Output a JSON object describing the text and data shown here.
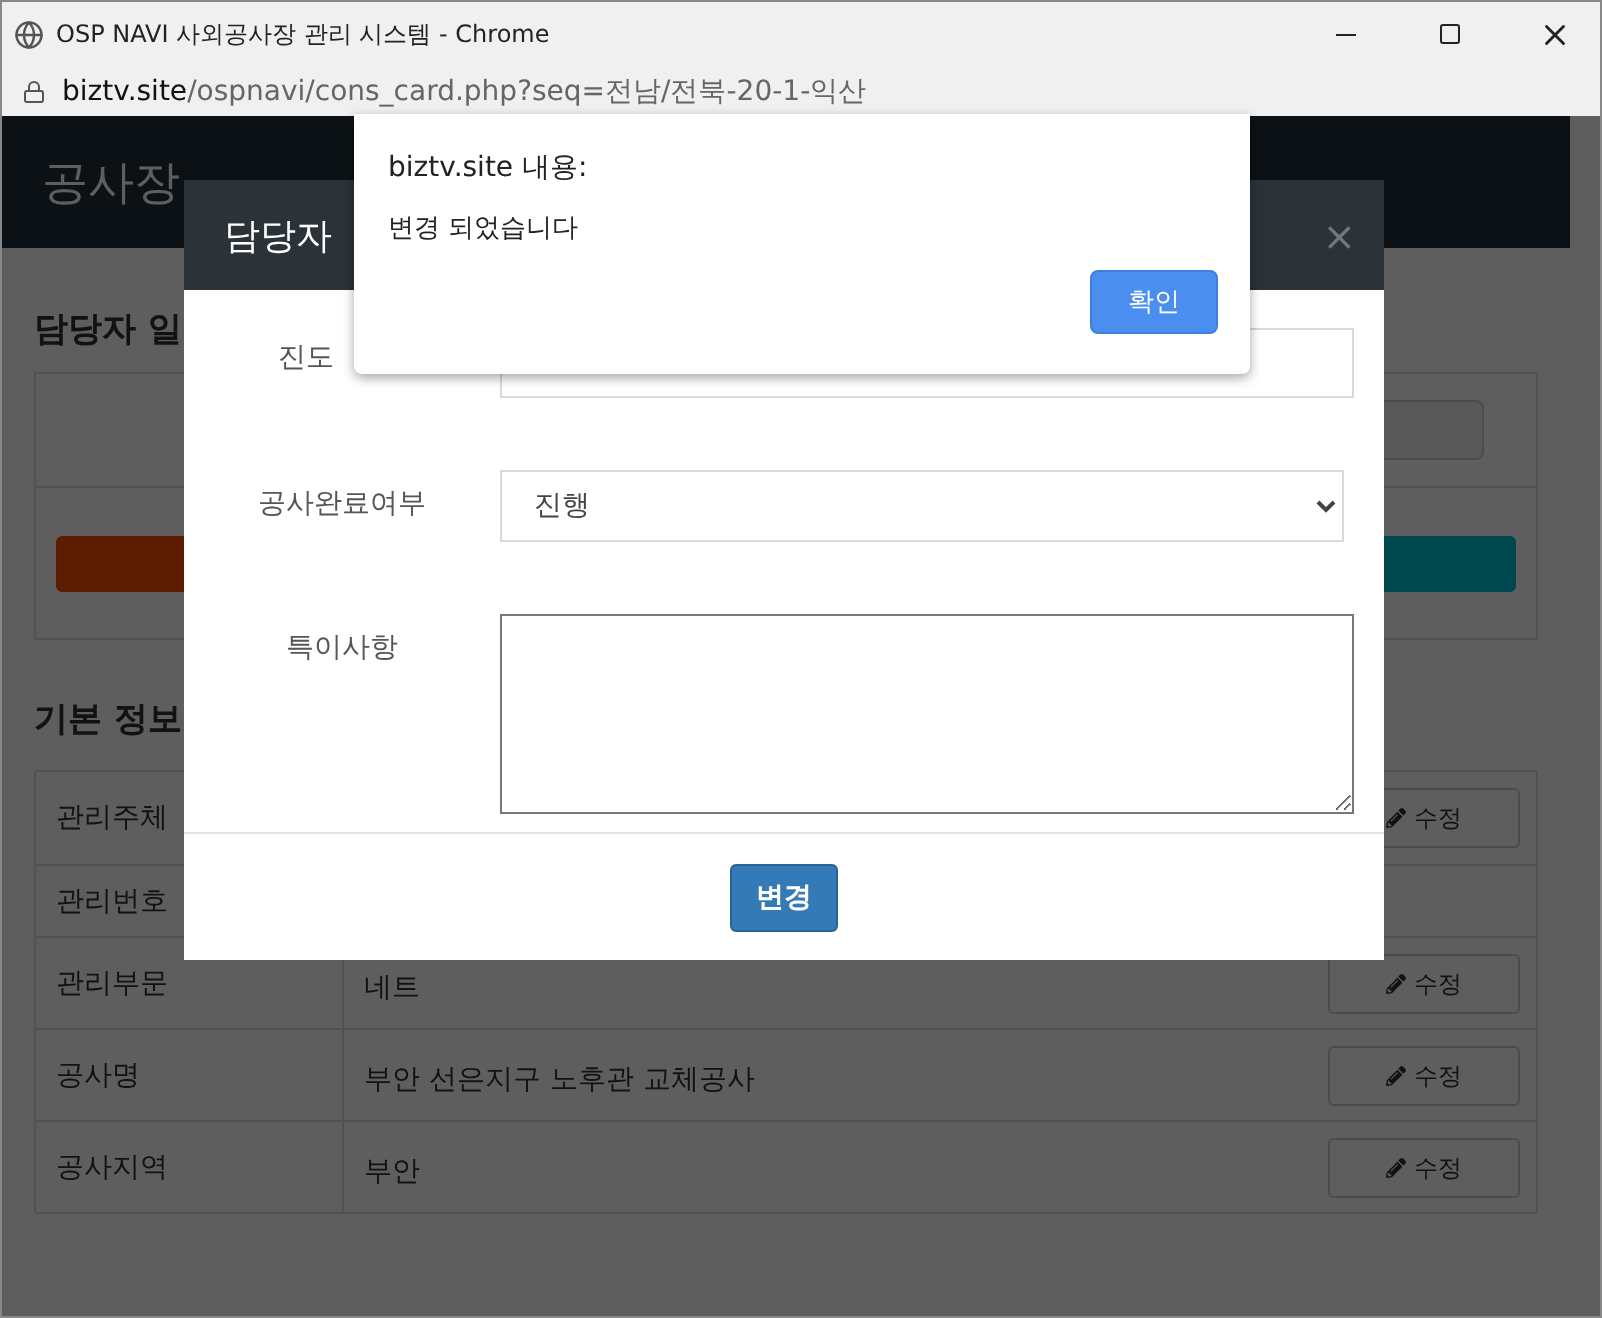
{
  "window": {
    "title": "OSP NAVI 사외공사장 관리 시스템 - Chrome"
  },
  "address_bar": {
    "domain": "biztv.site",
    "path": "/ospnavi/cons_card.php?seq=전남/전북-20-1-익산"
  },
  "page": {
    "header_title": "공사장",
    "contact_section": {
      "title": "담당자 일"
    },
    "basic_info": {
      "title": "기본 정보",
      "rows": [
        {
          "label": "관리주체",
          "edit": "수정"
        },
        {
          "label": "관리번호"
        },
        {
          "label": "관리부문",
          "value": "네트",
          "edit": "수정"
        },
        {
          "label": "공사명",
          "value": "부안 선은지구 노후관 교체공사",
          "edit": "수정"
        },
        {
          "label": "공사지역",
          "value": "부안",
          "edit": "수정"
        }
      ]
    }
  },
  "modal": {
    "title": "담당자",
    "close": "×",
    "fields": [
      {
        "label": "진도",
        "kind": "text"
      },
      {
        "label": "공사완료여부",
        "kind": "select",
        "value": "진행"
      },
      {
        "label": "특이사항",
        "kind": "textarea"
      }
    ],
    "submit": "변경"
  },
  "alert": {
    "title": "biztv.site 내용:",
    "message": "변경 되었습니다",
    "button": "확인"
  }
}
